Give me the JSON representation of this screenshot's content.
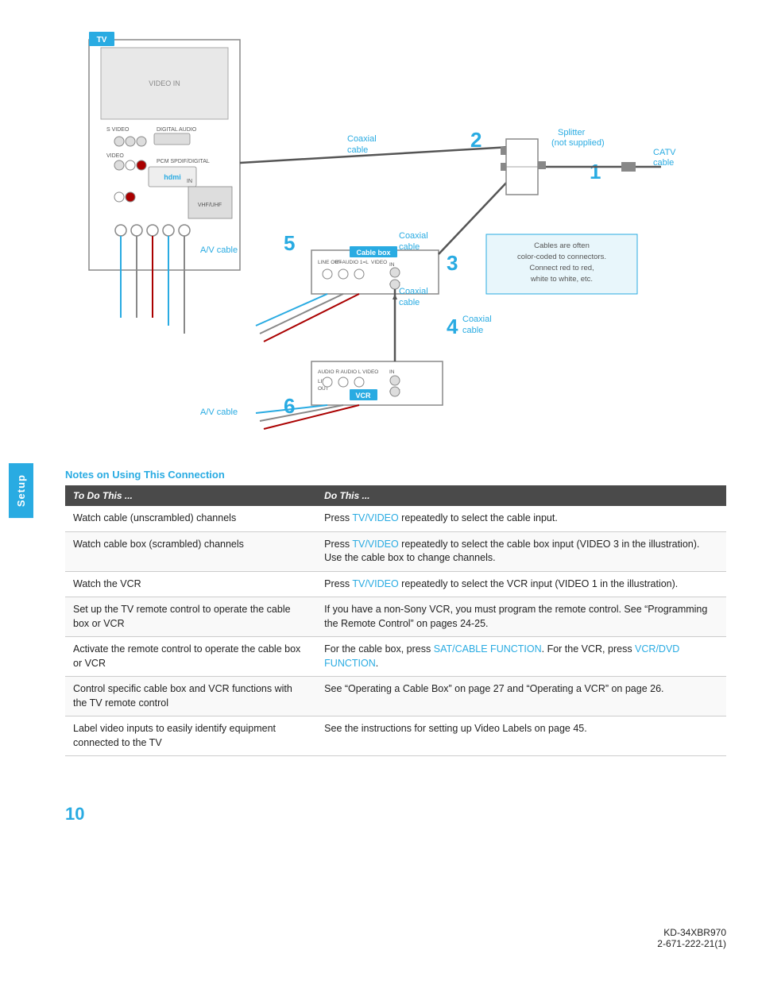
{
  "sidebar": {
    "label": "Setup"
  },
  "diagram": {
    "labels": {
      "tv": "TV",
      "splitter": "Splitter\n(not supplied)",
      "catv_cable": "CATV\ncable",
      "coaxial_cable_1": "Coaxial\ncable",
      "coaxial_cable_2": "Coaxial\ncable",
      "coaxial_cable_3": "Coaxial\ncable",
      "cable_box": "Cable box",
      "vcr": "VCR",
      "av_cable_1": "A/V cable",
      "av_cable_2": "A/V cable",
      "color_note": "Cables are often\ncolor-coded to connectors.\nConnect red to red,\nwhite to white, etc.",
      "num1": "1",
      "num2": "2",
      "num3": "3",
      "num4": "4",
      "num5": "5",
      "num6": "6"
    }
  },
  "notes": {
    "title": "Notes on Using This Connection",
    "table": {
      "col1": "To Do This ...",
      "col2": "Do This ...",
      "rows": [
        {
          "col1": "Watch cable (unscrambled) channels",
          "col2": "Press TV/VIDEO repeatedly to select the cable input.",
          "col2_cyan": "TV/VIDEO"
        },
        {
          "col1": "Watch cable box (scrambled) channels",
          "col2": "Press TV/VIDEO repeatedly to select the cable box input (VIDEO 3 in the illustration). Use the cable box to change channels.",
          "col2_cyan": "TV/VIDEO"
        },
        {
          "col1": "Watch the VCR",
          "col2": "Press TV/VIDEO repeatedly to select the VCR input (VIDEO 1 in the illustration).",
          "col2_cyan": "TV/VIDEO"
        },
        {
          "col1": "Set up the TV remote control to operate the cable box or VCR",
          "col2": "If you have a non-Sony VCR, you must program the remote control. See “Programming the Remote Control” on pages 24-25.",
          "col2_cyan": ""
        },
        {
          "col1": "Activate the remote control to operate the cable box or VCR",
          "col2": "For the cable box, press SAT/CABLE FUNCTION. For the VCR, press VCR/DVD FUNCTION.",
          "col2_cyan_parts": [
            "SAT/CABLE FUNCTION",
            "VCR/DVD\nFUNCTION."
          ]
        },
        {
          "col1": "Control specific cable box and VCR functions with the TV remote control",
          "col2": "See “Operating a Cable Box” on page 27 and “Operating a VCR” on page 26.",
          "col2_cyan": ""
        },
        {
          "col1": "Label video inputs to easily identify equipment connected to the TV",
          "col2": "See the instructions for setting up Video Labels on page 45.",
          "col2_cyan": ""
        }
      ]
    }
  },
  "footer": {
    "page_number": "10",
    "doc_ref_line1": "KD-34XBR970",
    "doc_ref_line2": "2-671-222-21(1)"
  }
}
